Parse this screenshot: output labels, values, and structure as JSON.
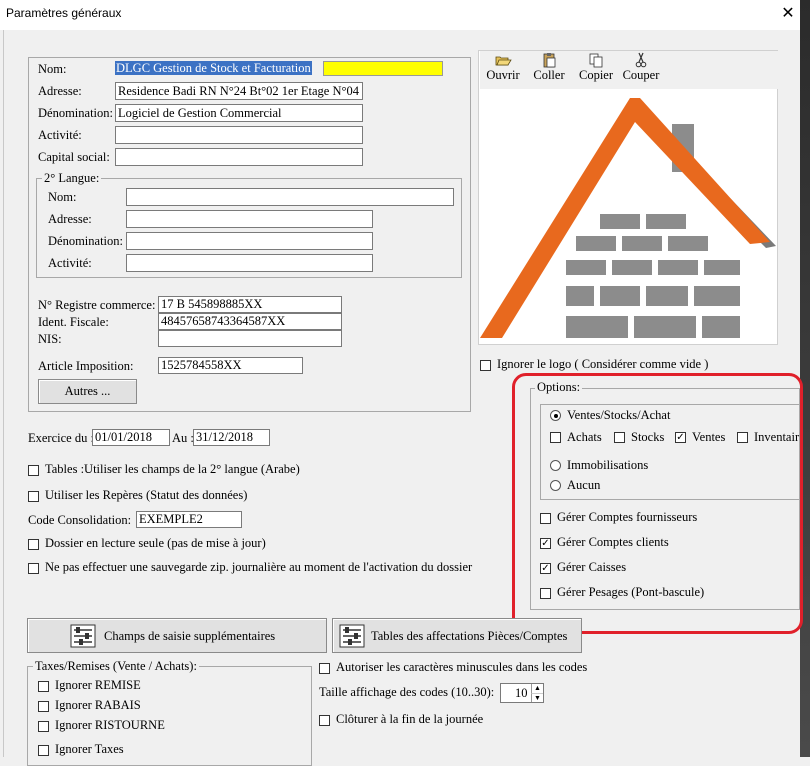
{
  "window": {
    "title": "Paramètres généraux",
    "close_glyph": "✕"
  },
  "identity": {
    "nom_label": "Nom:",
    "nom_value": "DLGC Gestion de Stock et Facturation",
    "adresse_label": "Adresse:",
    "adresse_value": "Residence Badi RN N°24 Bt°02 1er Etage N°04",
    "denomination_label": "Dénomination:",
    "denomination_value": "Logiciel de Gestion Commercial",
    "activite_label": "Activité:",
    "activite_value": "",
    "capital_label": "Capital social:",
    "capital_value": ""
  },
  "second_language": {
    "legend": "2° Langue:",
    "nom_label": "Nom:",
    "adresse_label": "Adresse:",
    "denomination_label": "Dénomination:",
    "activite_label": "Activité:"
  },
  "registry": {
    "rc_label": "N° Registre commerce:",
    "rc_value": "17 B 545898885XX",
    "fiscal_label": "Ident. Fiscale:",
    "fiscal_value": "48457658743364587XX",
    "nis_label": "NIS:",
    "nis_value": "",
    "article_label": "Article Imposition:",
    "article_value": "1525784558XX",
    "autres_button": "Autres ..."
  },
  "logo_toolbar": {
    "ouvrir": "Ouvrir",
    "coller": "Coller",
    "copier": "Copier",
    "couper": "Couper"
  },
  "logo_ignore_label": "Ignorer le logo ( Considérer comme vide )",
  "exercice": {
    "label": "Exercice du :",
    "from": "01/01/2018",
    "au_label": "Au :",
    "to": "31/12/2018"
  },
  "left_options": {
    "tables_label": "Tables :Utiliser les champs de la 2° langue (Arabe)",
    "reperes_label": "Utiliser les Repères (Statut des données)",
    "consolidation_label": "Code Consolidation:",
    "consolidation_value": "EXEMPLE2",
    "lecture_seule_label": "Dossier en lecture seule (pas de mise à jour)",
    "sauvegarde_label": "Ne pas effectuer une sauvegarde zip. journalière au moment de l'activation du dossier"
  },
  "options": {
    "legend": "Options:",
    "radio_ventes": "Ventes/Stocks/Achat",
    "achats": "Achats",
    "stocks": "Stocks",
    "ventes": "Ventes",
    "inventaire": "Inventair",
    "immobilisations": "Immobilisations",
    "aucun": "Aucun",
    "fournisseurs": "Gérer Comptes fournisseurs",
    "clients": "Gérer Comptes clients",
    "caisses": "Gérer Caisses",
    "pesages": "Gérer Pesages (Pont-bascule)"
  },
  "buttons": {
    "champs_saisie": "Champs de saisie supplémentaires",
    "tables_affectations": "Tables des affectations Pièces/Comptes"
  },
  "taxes": {
    "legend": "Taxes/Remises (Vente / Achats):",
    "remise": "Ignorer REMISE",
    "rabais": "Ignorer RABAIS",
    "ristourne": "Ignorer RISTOURNE",
    "taxes": "Ignorer Taxes"
  },
  "codes": {
    "minuscules_label": "Autoriser les caractères minuscules dans les codes",
    "taille_label": "Taille affichage des codes (10..30):",
    "taille_value": "10",
    "cloturer_label": "Clôturer à la fin de la journée"
  },
  "colors": {
    "highlight_circle": "#e0202a",
    "roof_orange": "#e8691e",
    "roof_gray": "#7a7a7a",
    "brick_gray": "#8c8c8c",
    "selection_blue": "#3c72c4",
    "yellow_field": "#ffff00"
  }
}
